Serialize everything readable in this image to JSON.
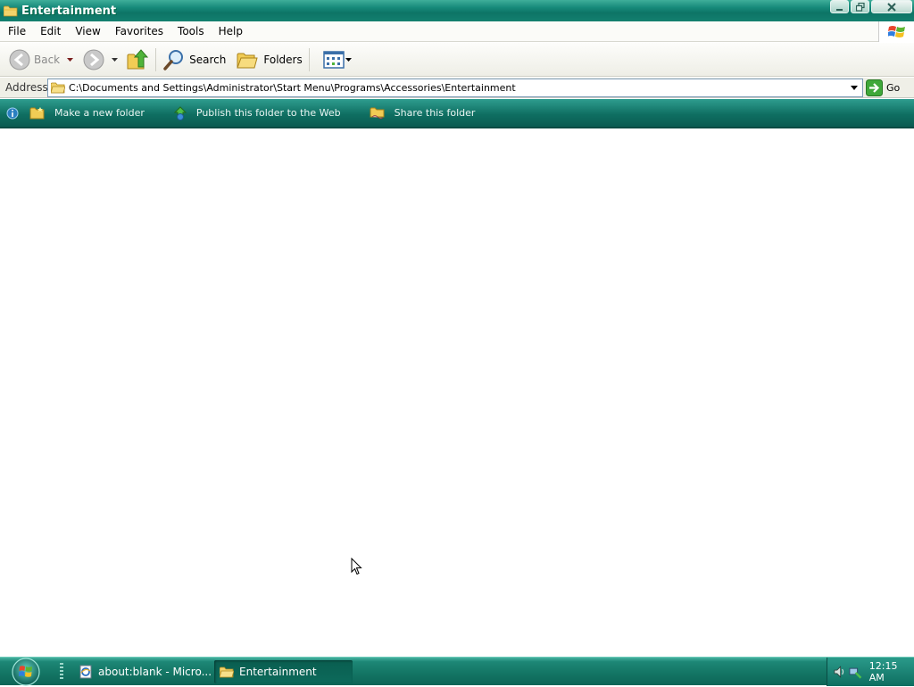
{
  "window": {
    "title": "Entertainment"
  },
  "menu": [
    "File",
    "Edit",
    "View",
    "Favorites",
    "Tools",
    "Help"
  ],
  "toolbar": {
    "back_label": "Back",
    "search_label": "Search",
    "folders_label": "Folders"
  },
  "address": {
    "label": "Address",
    "value": "C:\\Documents and Settings\\Administrator\\Start Menu\\Programs\\Accessories\\Entertainment",
    "go_label": "Go"
  },
  "tasks": {
    "make_folder": "Make a new folder",
    "publish": "Publish this folder to the Web",
    "share": "Share this folder"
  },
  "taskbar": {
    "items": [
      {
        "label": "about:blank - Micro...",
        "icon": "ie-page-icon"
      },
      {
        "label": "Entertainment",
        "icon": "folder-icon"
      }
    ],
    "clock": "12:15 AM"
  },
  "colors": {
    "title_bar": "#178a7a",
    "task_pane": "#0f6f62",
    "taskbar": "#137463"
  }
}
